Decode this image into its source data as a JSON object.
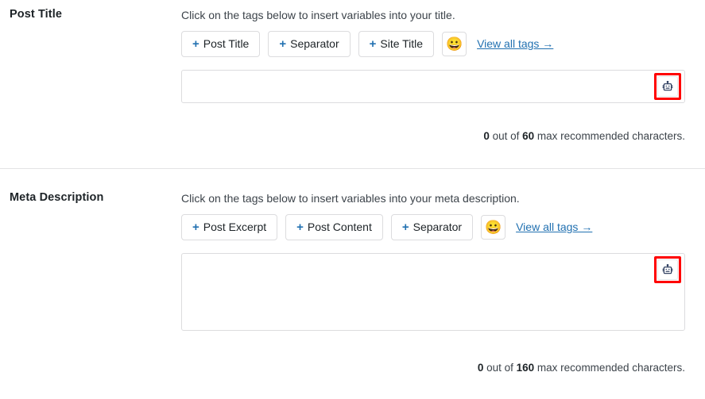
{
  "sections": [
    {
      "label": "Post Title",
      "hint": "Click on the tags below to insert variables into your title.",
      "tags": [
        {
          "plus": "+",
          "label": "Post Title"
        },
        {
          "plus": "+",
          "label": "Separator"
        },
        {
          "plus": "+",
          "label": "Site Title"
        }
      ],
      "emoji_button": {
        "glyph": "😀",
        "icon_name": "grinning-face-emoji-icon"
      },
      "view_all_link": "View all tags →",
      "field": {
        "value": "",
        "placeholder": ""
      },
      "ai_button": {
        "icon_name": "robot-icon",
        "highlight_color": "#ff0000"
      },
      "counter": {
        "count": "0",
        "middle": " out of ",
        "max": "60",
        "suffix": " max recommended characters."
      }
    },
    {
      "label": "Meta Description",
      "hint": "Click on the tags below to insert variables into your meta description.",
      "tags": [
        {
          "plus": "+",
          "label": "Post Excerpt"
        },
        {
          "plus": "+",
          "label": "Post Content"
        },
        {
          "plus": "+",
          "label": "Separator"
        }
      ],
      "emoji_button": {
        "glyph": "😀",
        "icon_name": "grinning-face-emoji-icon"
      },
      "view_all_link": "View all tags →",
      "field": {
        "value": "",
        "placeholder": ""
      },
      "ai_button": {
        "icon_name": "robot-icon",
        "highlight_color": "#ff0000"
      },
      "counter": {
        "count": "0",
        "middle": " out of ",
        "max": "160",
        "suffix": " max recommended characters."
      }
    }
  ],
  "colors": {
    "accent_link": "#2271b1",
    "highlight": "#ff0000",
    "border": "#dcdcde",
    "text": "#1d2327"
  }
}
